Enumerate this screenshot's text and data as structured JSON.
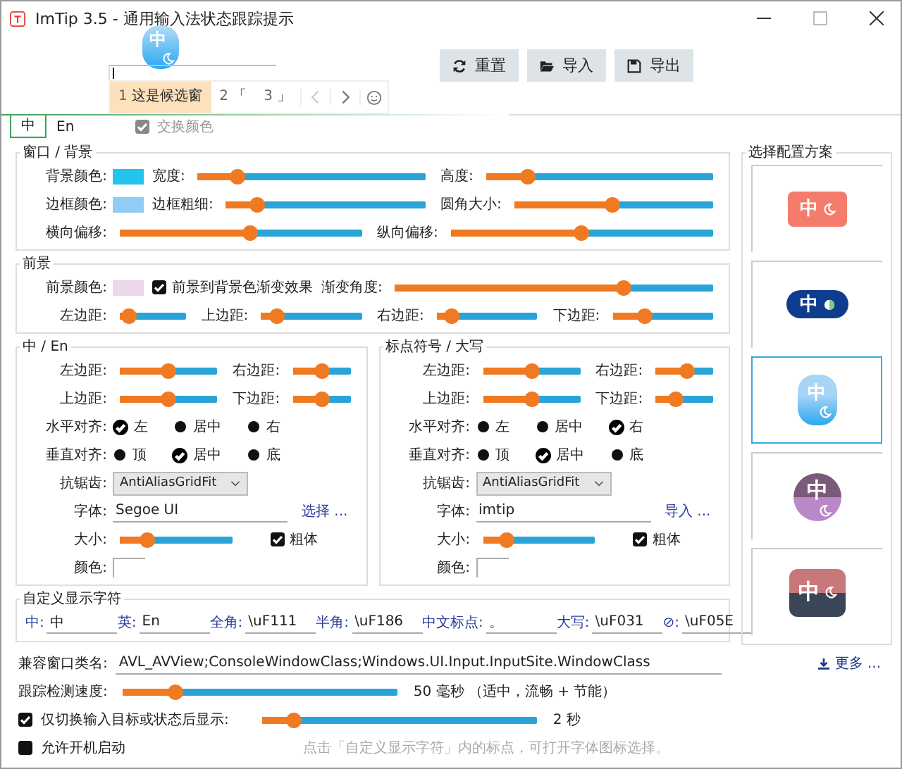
{
  "window": {
    "title": "ImTip 3.5 - 通用输入法状态跟踪提示"
  },
  "preview": {
    "indicator": "中",
    "candidates": [
      {
        "index": "1",
        "text": "这是候选窗",
        "selected": true
      },
      {
        "index": "2",
        "text": "「",
        "selected": false
      },
      {
        "index": "3",
        "text": "」",
        "selected": false
      }
    ]
  },
  "toolbar": [
    {
      "label": "重置",
      "kind": "reset"
    },
    {
      "label": "导入",
      "kind": "import"
    },
    {
      "label": "导出",
      "kind": "export"
    }
  ],
  "tabs": [
    {
      "label": "中",
      "selected": true
    },
    {
      "label": "En",
      "selected": false
    }
  ],
  "swap_colors": {
    "label": "交换颜色",
    "checked": true,
    "disabled": true
  },
  "groups": [
    {
      "title": "窗口 / 背景",
      "rows": [
        [
          {
            "kind": "color",
            "label": "背景颜色:",
            "color": "#22c4ee"
          },
          {
            "kind": "slider",
            "label": "宽度:",
            "level": 0.15
          },
          {
            "kind": "slider",
            "label": "高度:",
            "level": 0.16
          }
        ],
        [
          {
            "kind": "color",
            "label": "边框颜色:",
            "color": "#90ccf4"
          },
          {
            "kind": "slider",
            "label": "边框粗细:",
            "level": 0.13
          },
          {
            "kind": "slider",
            "label": "圆角大小:",
            "level": 0.49
          }
        ],
        [
          {
            "kind": "slider",
            "label": "横向偏移:",
            "level": 0.54
          },
          {
            "kind": "slider",
            "label": "纵向偏移:",
            "level": 0.5
          }
        ]
      ]
    },
    {
      "title": "前景",
      "rows": [
        [
          {
            "kind": "color",
            "label": "前景颜色:",
            "color": "#ecd8ec"
          },
          {
            "kind": "check",
            "label": "前景到背景色渐变效果",
            "checked": true
          },
          {
            "kind": "slider",
            "label": "渐变角度:",
            "level": 0.73
          }
        ],
        [
          {
            "kind": "slider",
            "label": "左边距:",
            "level": 0.03
          },
          {
            "kind": "slider",
            "label": "上边距:",
            "level": 0.1
          },
          {
            "kind": "slider",
            "label": "右边距:",
            "level": 0.08
          },
          {
            "kind": "slider",
            "label": "下边距:",
            "level": 0.28
          }
        ]
      ]
    },
    {
      "title": "中 / En",
      "rows": [
        [
          {
            "kind": "slider",
            "label": "左边距:",
            "level": 0.5
          },
          {
            "kind": "slider",
            "label": "右边距:",
            "level": 0.5
          }
        ],
        [
          {
            "kind": "slider",
            "label": "上边距:",
            "level": 0.5
          },
          {
            "kind": "slider",
            "label": "下边距:",
            "level": 0.5
          }
        ],
        [
          {
            "kind": "radios",
            "label": "水平对齐:",
            "options": [
              {
                "label": "左",
                "selected": true
              },
              {
                "label": "居中",
                "selected": false
              },
              {
                "label": "右",
                "selected": false
              }
            ]
          }
        ],
        [
          {
            "kind": "radios",
            "label": "垂直对齐:",
            "options": [
              {
                "label": "顶",
                "selected": false
              },
              {
                "label": "居中",
                "selected": true
              },
              {
                "label": "底",
                "selected": false
              }
            ]
          }
        ],
        [
          {
            "kind": "select",
            "label": "抗锯齿:",
            "value": "AntiAliasGridFit"
          }
        ],
        [
          {
            "kind": "font",
            "label": "字体:",
            "value": "Segoe UI",
            "link": "选择 ..."
          }
        ],
        [
          {
            "kind": "slider",
            "label": "大小:",
            "level": 0.2
          },
          {
            "kind": "check",
            "label": "粗体",
            "checked": true
          }
        ],
        [
          {
            "kind": "color",
            "label": "颜色:",
            "color": "#ffffff"
          }
        ]
      ]
    },
    {
      "title": "标点符号 / 大写",
      "rows": [
        [
          {
            "kind": "slider",
            "label": "左边距:",
            "level": 0.5
          },
          {
            "kind": "slider",
            "label": "右边距:",
            "level": 0.55
          }
        ],
        [
          {
            "kind": "slider",
            "label": "上边距:",
            "level": 0.5
          },
          {
            "kind": "slider",
            "label": "下边距:",
            "level": 0.31
          }
        ],
        [
          {
            "kind": "radios",
            "label": "水平对齐:",
            "options": [
              {
                "label": "左",
                "selected": false
              },
              {
                "label": "居中",
                "selected": false
              },
              {
                "label": "右",
                "selected": true
              }
            ]
          }
        ],
        [
          {
            "kind": "radios",
            "label": "垂直对齐:",
            "options": [
              {
                "label": "顶",
                "selected": false
              },
              {
                "label": "居中",
                "selected": true
              },
              {
                "label": "底",
                "selected": false
              }
            ]
          }
        ],
        [
          {
            "kind": "select",
            "label": "抗锯齿:",
            "value": "AntiAliasGridFit"
          }
        ],
        [
          {
            "kind": "font",
            "label": "字体:",
            "value": "imtip",
            "link": "导入 ..."
          }
        ],
        [
          {
            "kind": "slider",
            "label": "大小:",
            "level": 0.17
          },
          {
            "kind": "check",
            "label": "粗体",
            "checked": true
          }
        ],
        [
          {
            "kind": "color",
            "label": "颜色:",
            "color": "#ffffff"
          }
        ]
      ]
    }
  ],
  "custom_chars": {
    "title": "自定义显示字符",
    "items": [
      {
        "label": "中:",
        "value": "中"
      },
      {
        "label": "英:",
        "value": "En"
      },
      {
        "label": "全角:",
        "value": "\\uF111"
      },
      {
        "label": "半角:",
        "value": "\\uF186"
      },
      {
        "label": "中文标点:",
        "value": "。"
      },
      {
        "label": "大写:",
        "value": "\\uF031"
      },
      {
        "label": "⊘:",
        "value": "\\uF05E"
      }
    ]
  },
  "presets": {
    "title": "选择配置方案",
    "items": [
      {
        "label": "中",
        "kind": "rect",
        "color": "#f47c6c",
        "selected": false
      },
      {
        "label": "中",
        "kind": "pill",
        "color": "#0d3d8c",
        "selected": false
      },
      {
        "label": "中",
        "kind": "bubble",
        "color": "#a8d4f6",
        "selected": true
      },
      {
        "label": "中",
        "kind": "circle",
        "color": "#7a5a78",
        "selected": false
      },
      {
        "label": "中",
        "kind": "split",
        "color": "#c87878",
        "selected": false
      }
    ]
  },
  "more_link": "更多 ...",
  "compat": {
    "label": "兼容窗口类名:",
    "value": "AVL_AVView;ConsoleWindowClass;Windows.UI.Input.InputSite.WindowClass"
  },
  "speed": {
    "label": "跟踪检测速度:",
    "level": 0.17,
    "reading": "50 毫秒 （适中，流畅 + 节能）"
  },
  "show_after": {
    "label": "仅切换输入目标或状态后显示:",
    "checked": true,
    "level": 0.09,
    "reading": "2 秒"
  },
  "autostart": {
    "label": "允许开机启动",
    "checked": false
  },
  "hint": "点击「自定义显示字符」内的标点，可打开字体图标选择。"
}
